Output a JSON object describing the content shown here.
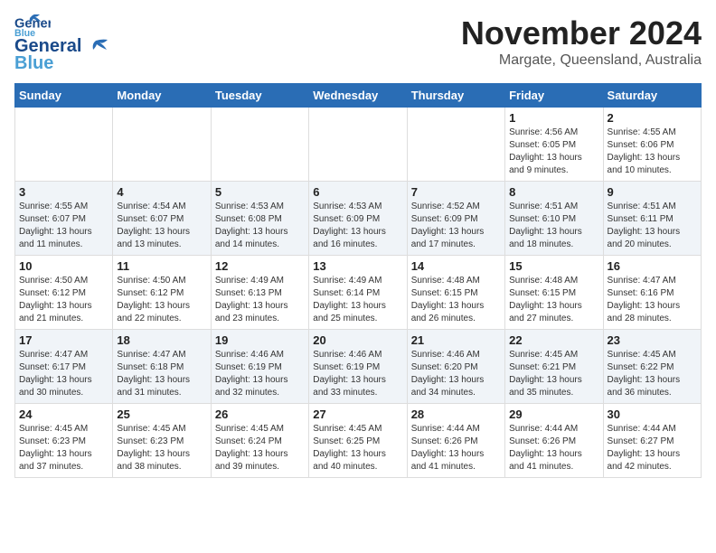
{
  "header": {
    "logo_line1": "General",
    "logo_line2": "Blue",
    "month": "November 2024",
    "location": "Margate, Queensland, Australia"
  },
  "weekdays": [
    "Sunday",
    "Monday",
    "Tuesday",
    "Wednesday",
    "Thursday",
    "Friday",
    "Saturday"
  ],
  "weeks": [
    [
      {
        "day": "",
        "info": ""
      },
      {
        "day": "",
        "info": ""
      },
      {
        "day": "",
        "info": ""
      },
      {
        "day": "",
        "info": ""
      },
      {
        "day": "",
        "info": ""
      },
      {
        "day": "1",
        "info": "Sunrise: 4:56 AM\nSunset: 6:05 PM\nDaylight: 13 hours and 9 minutes."
      },
      {
        "day": "2",
        "info": "Sunrise: 4:55 AM\nSunset: 6:06 PM\nDaylight: 13 hours and 10 minutes."
      }
    ],
    [
      {
        "day": "3",
        "info": "Sunrise: 4:55 AM\nSunset: 6:07 PM\nDaylight: 13 hours and 11 minutes."
      },
      {
        "day": "4",
        "info": "Sunrise: 4:54 AM\nSunset: 6:07 PM\nDaylight: 13 hours and 13 minutes."
      },
      {
        "day": "5",
        "info": "Sunrise: 4:53 AM\nSunset: 6:08 PM\nDaylight: 13 hours and 14 minutes."
      },
      {
        "day": "6",
        "info": "Sunrise: 4:53 AM\nSunset: 6:09 PM\nDaylight: 13 hours and 16 minutes."
      },
      {
        "day": "7",
        "info": "Sunrise: 4:52 AM\nSunset: 6:09 PM\nDaylight: 13 hours and 17 minutes."
      },
      {
        "day": "8",
        "info": "Sunrise: 4:51 AM\nSunset: 6:10 PM\nDaylight: 13 hours and 18 minutes."
      },
      {
        "day": "9",
        "info": "Sunrise: 4:51 AM\nSunset: 6:11 PM\nDaylight: 13 hours and 20 minutes."
      }
    ],
    [
      {
        "day": "10",
        "info": "Sunrise: 4:50 AM\nSunset: 6:12 PM\nDaylight: 13 hours and 21 minutes."
      },
      {
        "day": "11",
        "info": "Sunrise: 4:50 AM\nSunset: 6:12 PM\nDaylight: 13 hours and 22 minutes."
      },
      {
        "day": "12",
        "info": "Sunrise: 4:49 AM\nSunset: 6:13 PM\nDaylight: 13 hours and 23 minutes."
      },
      {
        "day": "13",
        "info": "Sunrise: 4:49 AM\nSunset: 6:14 PM\nDaylight: 13 hours and 25 minutes."
      },
      {
        "day": "14",
        "info": "Sunrise: 4:48 AM\nSunset: 6:15 PM\nDaylight: 13 hours and 26 minutes."
      },
      {
        "day": "15",
        "info": "Sunrise: 4:48 AM\nSunset: 6:15 PM\nDaylight: 13 hours and 27 minutes."
      },
      {
        "day": "16",
        "info": "Sunrise: 4:47 AM\nSunset: 6:16 PM\nDaylight: 13 hours and 28 minutes."
      }
    ],
    [
      {
        "day": "17",
        "info": "Sunrise: 4:47 AM\nSunset: 6:17 PM\nDaylight: 13 hours and 30 minutes."
      },
      {
        "day": "18",
        "info": "Sunrise: 4:47 AM\nSunset: 6:18 PM\nDaylight: 13 hours and 31 minutes."
      },
      {
        "day": "19",
        "info": "Sunrise: 4:46 AM\nSunset: 6:19 PM\nDaylight: 13 hours and 32 minutes."
      },
      {
        "day": "20",
        "info": "Sunrise: 4:46 AM\nSunset: 6:19 PM\nDaylight: 13 hours and 33 minutes."
      },
      {
        "day": "21",
        "info": "Sunrise: 4:46 AM\nSunset: 6:20 PM\nDaylight: 13 hours and 34 minutes."
      },
      {
        "day": "22",
        "info": "Sunrise: 4:45 AM\nSunset: 6:21 PM\nDaylight: 13 hours and 35 minutes."
      },
      {
        "day": "23",
        "info": "Sunrise: 4:45 AM\nSunset: 6:22 PM\nDaylight: 13 hours and 36 minutes."
      }
    ],
    [
      {
        "day": "24",
        "info": "Sunrise: 4:45 AM\nSunset: 6:23 PM\nDaylight: 13 hours and 37 minutes."
      },
      {
        "day": "25",
        "info": "Sunrise: 4:45 AM\nSunset: 6:23 PM\nDaylight: 13 hours and 38 minutes."
      },
      {
        "day": "26",
        "info": "Sunrise: 4:45 AM\nSunset: 6:24 PM\nDaylight: 13 hours and 39 minutes."
      },
      {
        "day": "27",
        "info": "Sunrise: 4:45 AM\nSunset: 6:25 PM\nDaylight: 13 hours and 40 minutes."
      },
      {
        "day": "28",
        "info": "Sunrise: 4:44 AM\nSunset: 6:26 PM\nDaylight: 13 hours and 41 minutes."
      },
      {
        "day": "29",
        "info": "Sunrise: 4:44 AM\nSunset: 6:26 PM\nDaylight: 13 hours and 41 minutes."
      },
      {
        "day": "30",
        "info": "Sunrise: 4:44 AM\nSunset: 6:27 PM\nDaylight: 13 hours and 42 minutes."
      }
    ]
  ]
}
